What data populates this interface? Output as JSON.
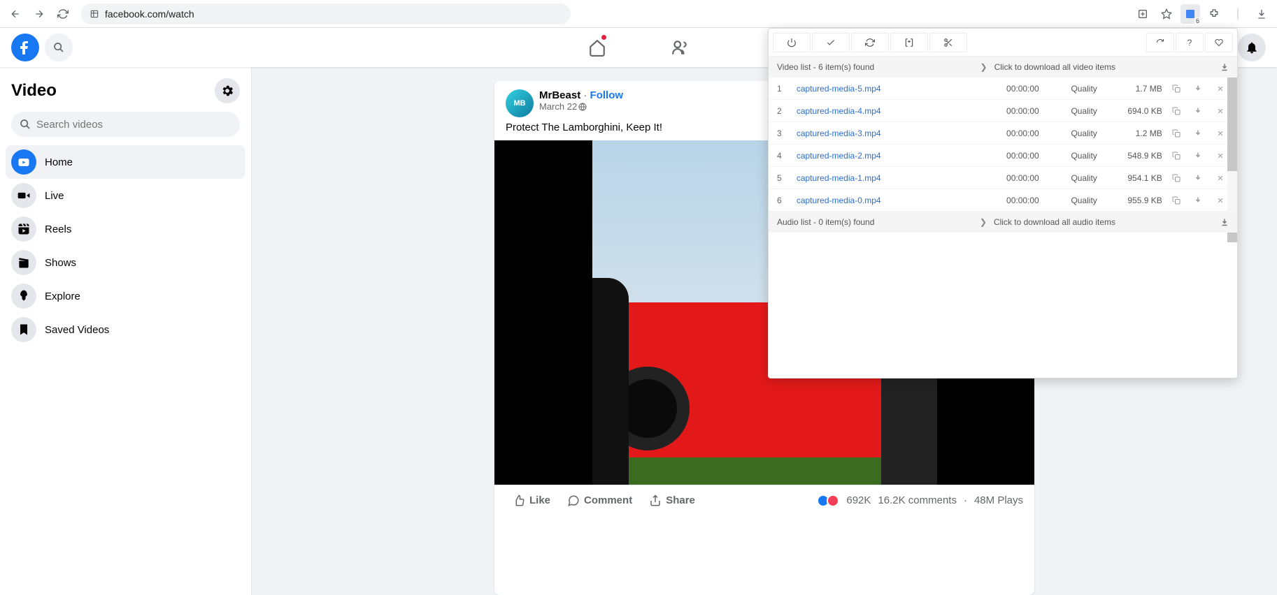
{
  "browser": {
    "url": "facebook.com/watch",
    "ext_badge": "6"
  },
  "sidebar": {
    "title": "Video",
    "search_placeholder": "Search videos",
    "items": [
      {
        "label": "Home",
        "icon": "play-circle-icon",
        "active": true
      },
      {
        "label": "Live",
        "icon": "video-icon",
        "active": false
      },
      {
        "label": "Reels",
        "icon": "film-icon",
        "active": false
      },
      {
        "label": "Shows",
        "icon": "clapper-icon",
        "active": false
      },
      {
        "label": "Explore",
        "icon": "rocket-icon",
        "active": false
      },
      {
        "label": "Saved Videos",
        "icon": "bookmark-icon",
        "active": false
      }
    ]
  },
  "post": {
    "author": "MrBeast",
    "follow": "Follow",
    "date": "March 22",
    "title": "Protect The Lamborghini, Keep It!",
    "actions": {
      "like": "Like",
      "comment": "Comment",
      "share": "Share"
    },
    "stats": {
      "reactions": "692K",
      "comments": "16.2K comments",
      "plays": "48M Plays"
    }
  },
  "ext": {
    "video_header": "Video list - 6 item(s) found",
    "video_click": "Click to download all video items",
    "audio_header": "Audio list - 0 item(s) found",
    "audio_click": "Click to download all audio items",
    "items": [
      {
        "idx": "1",
        "name": "captured-media-5.mp4",
        "dur": "00:00:00",
        "quality": "Quality",
        "size": "1.7 MB"
      },
      {
        "idx": "2",
        "name": "captured-media-4.mp4",
        "dur": "00:00:00",
        "quality": "Quality",
        "size": "694.0 KB"
      },
      {
        "idx": "3",
        "name": "captured-media-3.mp4",
        "dur": "00:00:00",
        "quality": "Quality",
        "size": "1.2 MB"
      },
      {
        "idx": "4",
        "name": "captured-media-2.mp4",
        "dur": "00:00:00",
        "quality": "Quality",
        "size": "548.9 KB"
      },
      {
        "idx": "5",
        "name": "captured-media-1.mp4",
        "dur": "00:00:00",
        "quality": "Quality",
        "size": "954.1 KB"
      },
      {
        "idx": "6",
        "name": "captured-media-0.mp4",
        "dur": "00:00:00",
        "quality": "Quality",
        "size": "955.9 KB"
      }
    ]
  }
}
